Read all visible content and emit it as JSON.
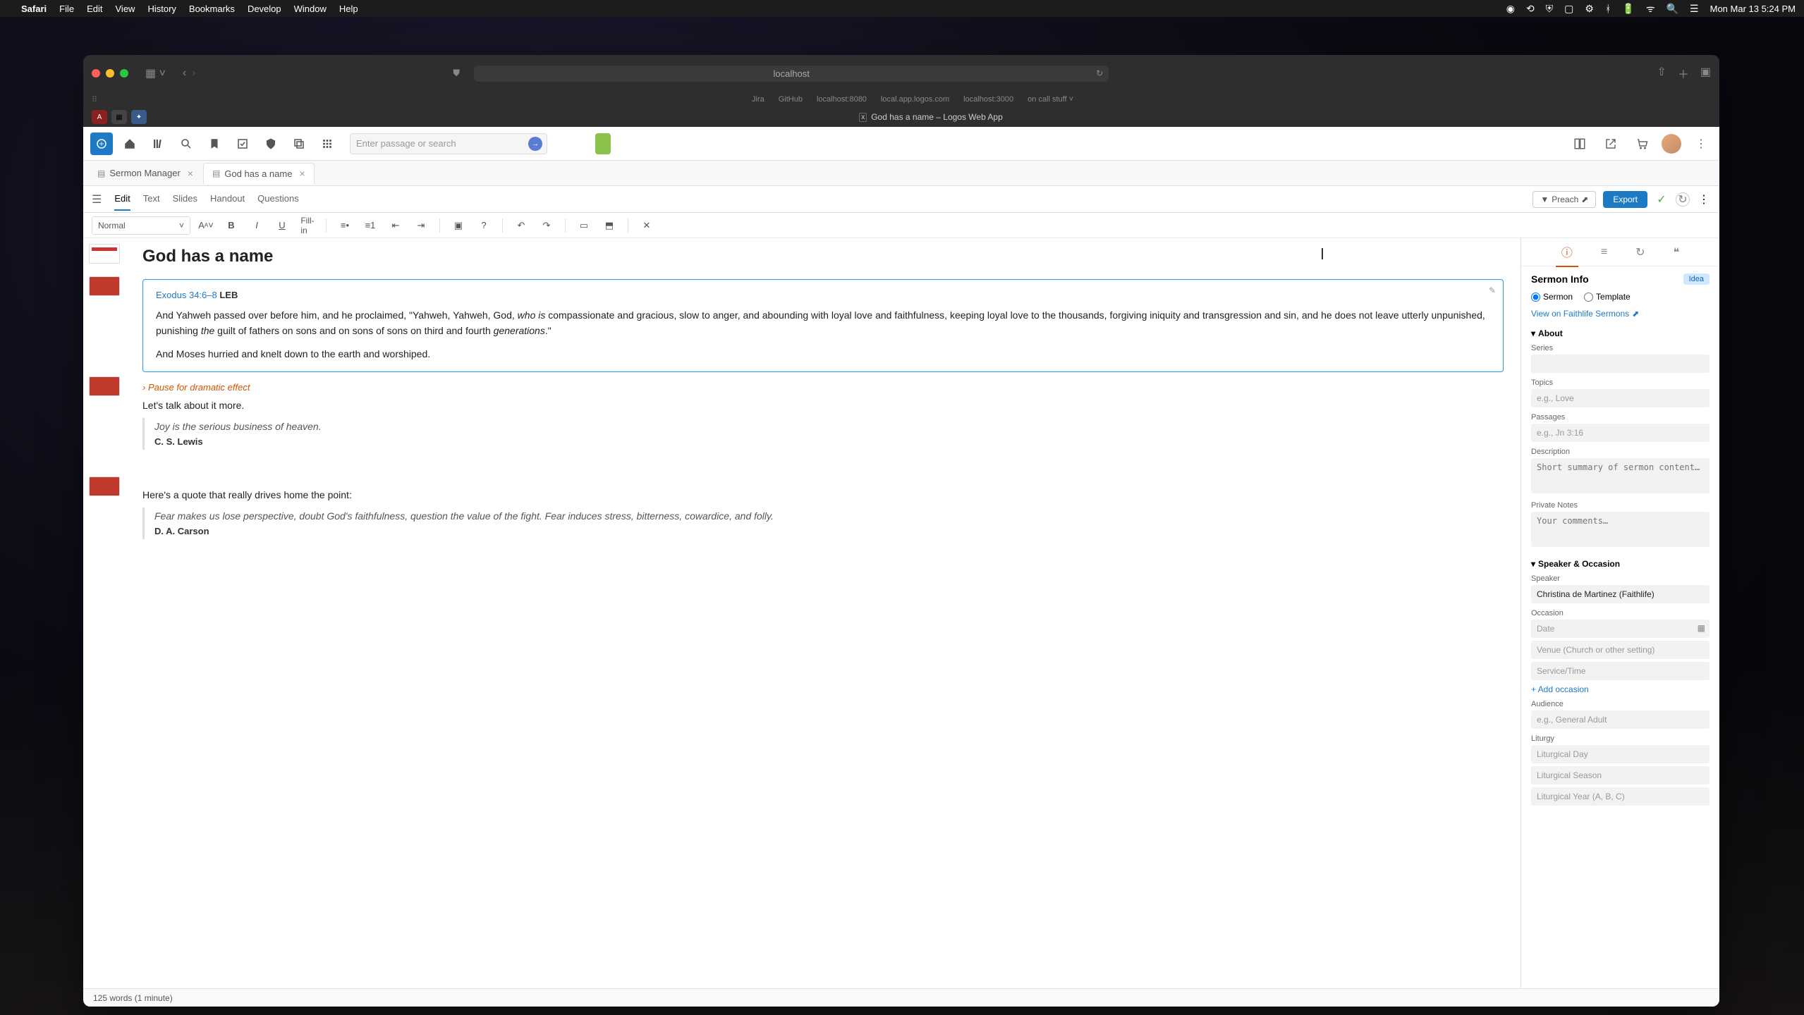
{
  "macos": {
    "app": "Safari",
    "menus": [
      "File",
      "Edit",
      "View",
      "History",
      "Bookmarks",
      "Develop",
      "Window",
      "Help"
    ],
    "clock": "Mon Mar 13  5:24 PM",
    "battery": "75%"
  },
  "safari": {
    "url": "localhost",
    "favorites": [
      "Jira",
      "GitHub",
      "localhost:8080",
      "local.app.logos.com",
      "localhost:3000",
      "on call stuff ˅"
    ],
    "tab_title": "God has a name – Logos Web App"
  },
  "app_toolbar": {
    "search_placeholder": "Enter passage or search"
  },
  "doc_tabs": [
    {
      "icon": "📄",
      "label": "Sermon Manager",
      "active": false
    },
    {
      "icon": "📝",
      "label": "God has a name",
      "active": true
    }
  ],
  "editor_modes": [
    "Edit",
    "Text",
    "Slides",
    "Handout",
    "Questions"
  ],
  "right_actions": {
    "preach": "Preach",
    "export": "Export"
  },
  "fmt": {
    "style": "Normal",
    "fillin": "Fill-in"
  },
  "document": {
    "title": "God has a name",
    "verse_ref": "Exodus 34:6–8",
    "verse_version": "LEB",
    "verse_p1_a": "And Yahweh passed over before him, and he proclaimed, \"Yahweh, Yahweh, God, ",
    "verse_p1_em1": "who is",
    "verse_p1_b": " compassionate and gracious, slow to anger, and abounding with loyal love and faithfulness, keeping loyal love to the thousands, forgiving iniquity and transgression and sin, and he does not leave utterly unpunished, punishing ",
    "verse_p1_em2": "the",
    "verse_p1_c": " guilt of fathers on sons and on sons of sons on third and fourth ",
    "verse_p1_em3": "generations",
    "verse_p1_d": ".\"",
    "verse_p2": "And Moses hurried and knelt down to the earth and worshiped.",
    "direction1": "Pause for dramatic effect",
    "body1": "Let's talk about it more.",
    "quote1_text": "Joy is the serious business of heaven.",
    "quote1_author": "C. S. Lewis",
    "body2": "Here's a quote that really drives home the point:",
    "quote2_text": "Fear makes us lose perspective, doubt God's faithfulness, question the value of the fight. Fear induces stress, bitterness, cowardice, and folly.",
    "quote2_author": "D. A. Carson"
  },
  "sidebar": {
    "title": "Sermon Info",
    "idea": "Idea",
    "radio_sermon": "Sermon",
    "radio_template": "Template",
    "view_link": "View on Faithlife Sermons",
    "about": "About",
    "series_label": "Series",
    "topics_label": "Topics",
    "topics_ph": "e.g., Love",
    "passages_label": "Passages",
    "passages_ph": "e.g., Jn 3:16",
    "description_label": "Description",
    "description_ph": "Short summary of sermon content…",
    "notes_label": "Private Notes",
    "notes_ph": "Your comments…",
    "speaker_section": "Speaker & Occasion",
    "speaker_label": "Speaker",
    "speaker_value": "Christina de Martinez (Faithlife)",
    "occasion_label": "Occasion",
    "date_ph": "Date",
    "venue_ph": "Venue (Church or other setting)",
    "service_ph": "Service/Time",
    "add_occasion": "+ Add occasion",
    "audience_label": "Audience",
    "audience_ph": "e.g., General Adult",
    "liturgy_label": "Liturgy",
    "lit_day_ph": "Liturgical Day",
    "lit_season_ph": "Liturgical Season",
    "lit_year_ph": "Liturgical Year (A, B, C)"
  },
  "status": "125 words (1 minute)"
}
